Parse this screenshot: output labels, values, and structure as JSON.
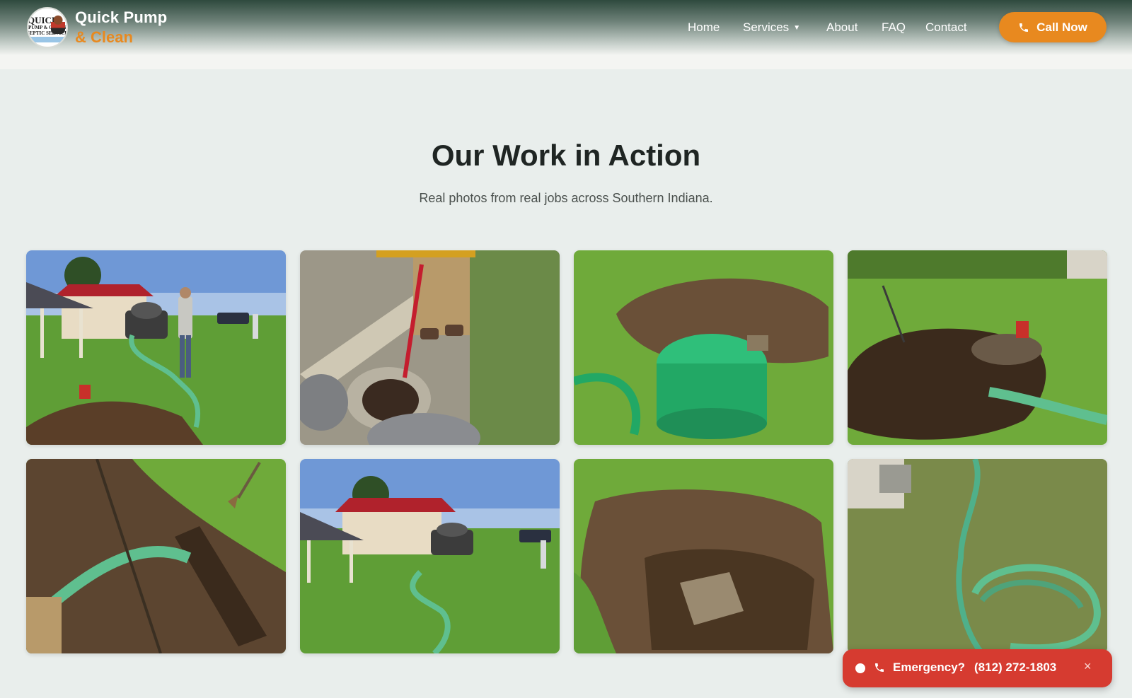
{
  "brand": {
    "line1": "Quick Pump",
    "line2": "& Clean",
    "logo_text": [
      "QUICK",
      "PUMP & CLEAN",
      "SEPTIC SERVICE"
    ]
  },
  "nav": {
    "home": "Home",
    "services": "Services",
    "about": "About",
    "faq": "FAQ",
    "contact": "Contact"
  },
  "cta": {
    "label": "Call Now"
  },
  "section": {
    "title": "Our Work in Action",
    "subtitle": "Real photos from real jobs across Southern Indiana."
  },
  "gallery": {
    "photos": [
      "septic-job-photo",
      "septic-job-photo",
      "septic-job-photo",
      "septic-job-photo",
      "septic-job-photo",
      "septic-job-photo",
      "septic-job-photo",
      "septic-job-photo"
    ]
  },
  "emergency": {
    "label": "Emergency?",
    "phone": "(812) 272-1803",
    "close": "×"
  },
  "colors": {
    "accent": "#e8891f",
    "emergency": "#d63b30",
    "page_bg": "#e9eeec",
    "header_dark": "#2f4a3e",
    "hose_green": "#5fbf8f",
    "grass": "#6faa3a"
  },
  "icons": [
    "phone-icon",
    "chevron-down-icon",
    "close-icon",
    "status-dot-icon",
    "logo-icon"
  ]
}
